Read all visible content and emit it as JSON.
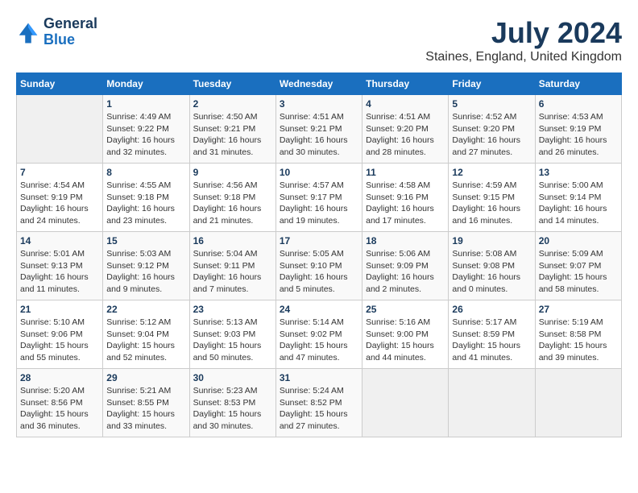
{
  "header": {
    "logo_line1": "General",
    "logo_line2": "Blue",
    "month": "July 2024",
    "location": "Staines, England, United Kingdom"
  },
  "days_header": [
    "Sunday",
    "Monday",
    "Tuesday",
    "Wednesday",
    "Thursday",
    "Friday",
    "Saturday"
  ],
  "weeks": [
    [
      {
        "day": "",
        "empty": true
      },
      {
        "day": "1",
        "sunrise": "Sunrise: 4:49 AM",
        "sunset": "Sunset: 9:22 PM",
        "daylight": "Daylight: 16 hours and 32 minutes."
      },
      {
        "day": "2",
        "sunrise": "Sunrise: 4:50 AM",
        "sunset": "Sunset: 9:21 PM",
        "daylight": "Daylight: 16 hours and 31 minutes."
      },
      {
        "day": "3",
        "sunrise": "Sunrise: 4:51 AM",
        "sunset": "Sunset: 9:21 PM",
        "daylight": "Daylight: 16 hours and 30 minutes."
      },
      {
        "day": "4",
        "sunrise": "Sunrise: 4:51 AM",
        "sunset": "Sunset: 9:20 PM",
        "daylight": "Daylight: 16 hours and 28 minutes."
      },
      {
        "day": "5",
        "sunrise": "Sunrise: 4:52 AM",
        "sunset": "Sunset: 9:20 PM",
        "daylight": "Daylight: 16 hours and 27 minutes."
      },
      {
        "day": "6",
        "sunrise": "Sunrise: 4:53 AM",
        "sunset": "Sunset: 9:19 PM",
        "daylight": "Daylight: 16 hours and 26 minutes."
      }
    ],
    [
      {
        "day": "7",
        "sunrise": "Sunrise: 4:54 AM",
        "sunset": "Sunset: 9:19 PM",
        "daylight": "Daylight: 16 hours and 24 minutes."
      },
      {
        "day": "8",
        "sunrise": "Sunrise: 4:55 AM",
        "sunset": "Sunset: 9:18 PM",
        "daylight": "Daylight: 16 hours and 23 minutes."
      },
      {
        "day": "9",
        "sunrise": "Sunrise: 4:56 AM",
        "sunset": "Sunset: 9:18 PM",
        "daylight": "Daylight: 16 hours and 21 minutes."
      },
      {
        "day": "10",
        "sunrise": "Sunrise: 4:57 AM",
        "sunset": "Sunset: 9:17 PM",
        "daylight": "Daylight: 16 hours and 19 minutes."
      },
      {
        "day": "11",
        "sunrise": "Sunrise: 4:58 AM",
        "sunset": "Sunset: 9:16 PM",
        "daylight": "Daylight: 16 hours and 17 minutes."
      },
      {
        "day": "12",
        "sunrise": "Sunrise: 4:59 AM",
        "sunset": "Sunset: 9:15 PM",
        "daylight": "Daylight: 16 hours and 16 minutes."
      },
      {
        "day": "13",
        "sunrise": "Sunrise: 5:00 AM",
        "sunset": "Sunset: 9:14 PM",
        "daylight": "Daylight: 16 hours and 14 minutes."
      }
    ],
    [
      {
        "day": "14",
        "sunrise": "Sunrise: 5:01 AM",
        "sunset": "Sunset: 9:13 PM",
        "daylight": "Daylight: 16 hours and 11 minutes."
      },
      {
        "day": "15",
        "sunrise": "Sunrise: 5:03 AM",
        "sunset": "Sunset: 9:12 PM",
        "daylight": "Daylight: 16 hours and 9 minutes."
      },
      {
        "day": "16",
        "sunrise": "Sunrise: 5:04 AM",
        "sunset": "Sunset: 9:11 PM",
        "daylight": "Daylight: 16 hours and 7 minutes."
      },
      {
        "day": "17",
        "sunrise": "Sunrise: 5:05 AM",
        "sunset": "Sunset: 9:10 PM",
        "daylight": "Daylight: 16 hours and 5 minutes."
      },
      {
        "day": "18",
        "sunrise": "Sunrise: 5:06 AM",
        "sunset": "Sunset: 9:09 PM",
        "daylight": "Daylight: 16 hours and 2 minutes."
      },
      {
        "day": "19",
        "sunrise": "Sunrise: 5:08 AM",
        "sunset": "Sunset: 9:08 PM",
        "daylight": "Daylight: 16 hours and 0 minutes."
      },
      {
        "day": "20",
        "sunrise": "Sunrise: 5:09 AM",
        "sunset": "Sunset: 9:07 PM",
        "daylight": "Daylight: 15 hours and 58 minutes."
      }
    ],
    [
      {
        "day": "21",
        "sunrise": "Sunrise: 5:10 AM",
        "sunset": "Sunset: 9:06 PM",
        "daylight": "Daylight: 15 hours and 55 minutes."
      },
      {
        "day": "22",
        "sunrise": "Sunrise: 5:12 AM",
        "sunset": "Sunset: 9:04 PM",
        "daylight": "Daylight: 15 hours and 52 minutes."
      },
      {
        "day": "23",
        "sunrise": "Sunrise: 5:13 AM",
        "sunset": "Sunset: 9:03 PM",
        "daylight": "Daylight: 15 hours and 50 minutes."
      },
      {
        "day": "24",
        "sunrise": "Sunrise: 5:14 AM",
        "sunset": "Sunset: 9:02 PM",
        "daylight": "Daylight: 15 hours and 47 minutes."
      },
      {
        "day": "25",
        "sunrise": "Sunrise: 5:16 AM",
        "sunset": "Sunset: 9:00 PM",
        "daylight": "Daylight: 15 hours and 44 minutes."
      },
      {
        "day": "26",
        "sunrise": "Sunrise: 5:17 AM",
        "sunset": "Sunset: 8:59 PM",
        "daylight": "Daylight: 15 hours and 41 minutes."
      },
      {
        "day": "27",
        "sunrise": "Sunrise: 5:19 AM",
        "sunset": "Sunset: 8:58 PM",
        "daylight": "Daylight: 15 hours and 39 minutes."
      }
    ],
    [
      {
        "day": "28",
        "sunrise": "Sunrise: 5:20 AM",
        "sunset": "Sunset: 8:56 PM",
        "daylight": "Daylight: 15 hours and 36 minutes."
      },
      {
        "day": "29",
        "sunrise": "Sunrise: 5:21 AM",
        "sunset": "Sunset: 8:55 PM",
        "daylight": "Daylight: 15 hours and 33 minutes."
      },
      {
        "day": "30",
        "sunrise": "Sunrise: 5:23 AM",
        "sunset": "Sunset: 8:53 PM",
        "daylight": "Daylight: 15 hours and 30 minutes."
      },
      {
        "day": "31",
        "sunrise": "Sunrise: 5:24 AM",
        "sunset": "Sunset: 8:52 PM",
        "daylight": "Daylight: 15 hours and 27 minutes."
      },
      {
        "day": "",
        "empty": true
      },
      {
        "day": "",
        "empty": true
      },
      {
        "day": "",
        "empty": true
      }
    ]
  ]
}
